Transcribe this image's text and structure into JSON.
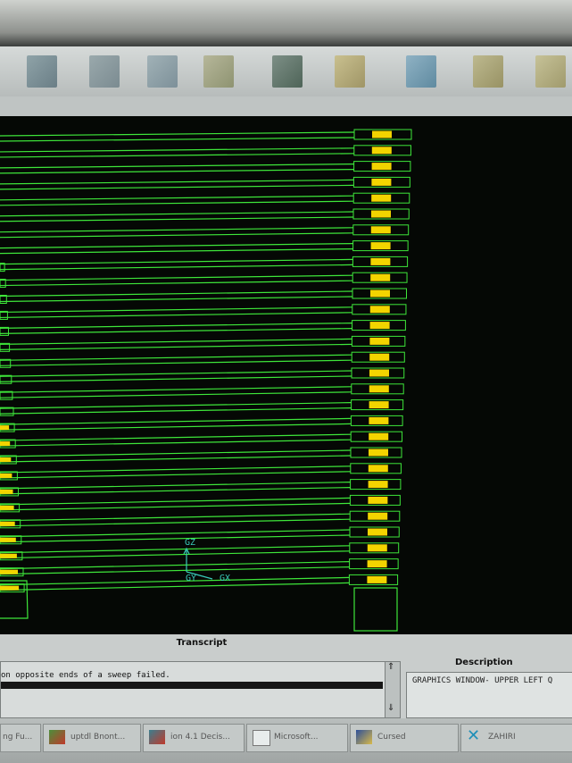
{
  "graphics": {
    "axis_z_label": "GZ",
    "axis_x_label": "GX",
    "axis_y_label": "GY",
    "wire_color": "#3ee63a",
    "pad_color": "#f3d400",
    "axis_color": "#39c9b8"
  },
  "transcript": {
    "title": "Transcript",
    "line": "on opposite ends of a sweep failed.",
    "scroll_up": "⇑",
    "scroll_down": "⇓"
  },
  "description": {
    "title": "Description",
    "text": "GRAPHICS WINDOW- UPPER LEFT Q"
  },
  "taskbar": {
    "items": [
      {
        "label": "ng Fu..."
      },
      {
        "label": "uptdl Bnont..."
      },
      {
        "label": "ion 4.1 Decis..."
      },
      {
        "label": "Microsoft..."
      },
      {
        "label": "Cursed"
      },
      {
        "label": "ZAHIRI"
      }
    ]
  }
}
